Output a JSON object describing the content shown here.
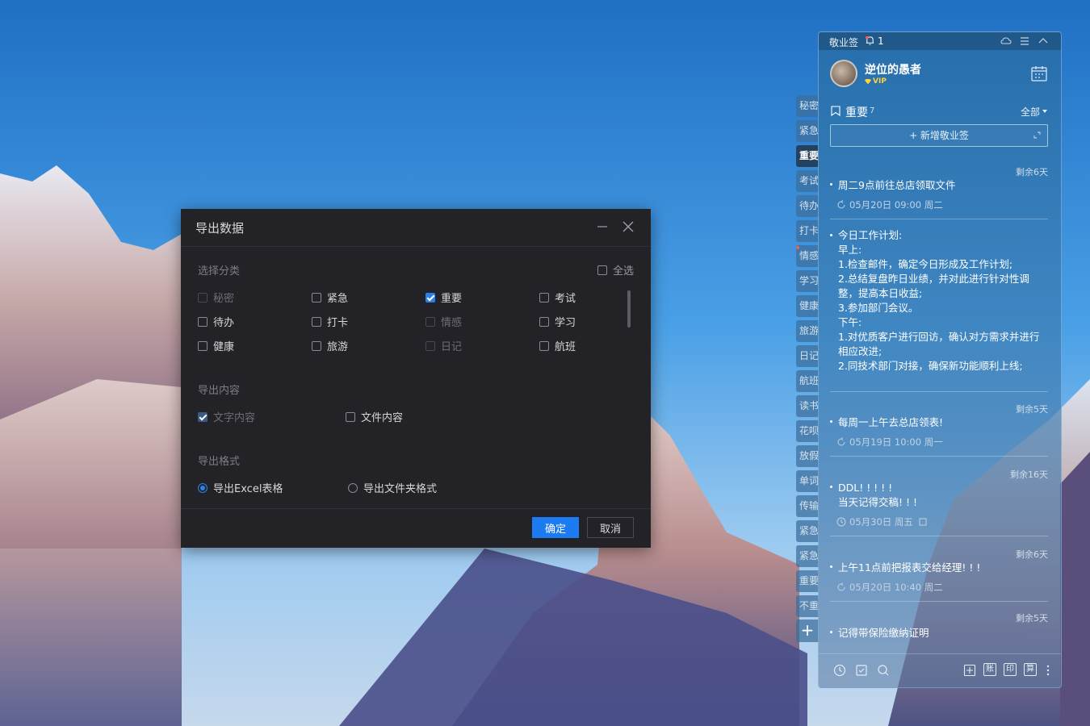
{
  "dialog": {
    "title": "导出数据",
    "category_label": "选择分类",
    "select_all": "全选",
    "categories": [
      {
        "label": "秘密",
        "checked": false,
        "disabled": true
      },
      {
        "label": "紧急",
        "checked": false,
        "disabled": false
      },
      {
        "label": "重要",
        "checked": true,
        "disabled": false
      },
      {
        "label": "考试",
        "checked": false,
        "disabled": false
      },
      {
        "label": "待办",
        "checked": false,
        "disabled": false
      },
      {
        "label": "打卡",
        "checked": false,
        "disabled": false
      },
      {
        "label": "情感",
        "checked": false,
        "disabled": true
      },
      {
        "label": "学习",
        "checked": false,
        "disabled": false
      },
      {
        "label": "健康",
        "checked": false,
        "disabled": false
      },
      {
        "label": "旅游",
        "checked": false,
        "disabled": false
      },
      {
        "label": "日记",
        "checked": false,
        "disabled": true
      },
      {
        "label": "航班",
        "checked": false,
        "disabled": false
      }
    ],
    "content_label": "导出内容",
    "content_text": "文字内容",
    "content_file": "文件内容",
    "format_label": "导出格式",
    "format_excel": "导出Excel表格",
    "format_folder": "导出文件夹格式",
    "ok": "确定",
    "cancel": "取消"
  },
  "side_tabs": [
    "秘密",
    "紧急",
    "重要",
    "考试",
    "待办",
    "打卡",
    "情感",
    "学习",
    "健康",
    "旅游",
    "日记",
    "航班",
    "读书",
    "花呗",
    "放假",
    "单词",
    "传输",
    "紧急",
    "紧急",
    "重要",
    "不重"
  ],
  "side_tab_add": "+",
  "panel": {
    "app_name": "敬业签",
    "notification_count": "1",
    "user_name": "逆位的愚者",
    "vip": "VIP",
    "category": "重要",
    "category_count": "7",
    "filter": "全部",
    "new_note": "+ 新增敬业签",
    "notes": [
      {
        "remain": "剩余6天",
        "text": "周二9点前往总店领取文件",
        "meta": "05月20日 09:00 周二"
      },
      {
        "text": "今日工作计划:\n早上:\n1.检查邮件，确定今日形成及工作计划;\n2.总结复盘昨日业绩，并对此进行针对性调整，提高本日收益;\n3.参加部门会议。\n下午:\n1.对优质客户进行回访，确认对方需求并进行相应改进;\n2.同技术部门对接，确保新功能顺利上线;"
      },
      {
        "remain": "剩余5天",
        "text": "每周一上午去总店领表!",
        "meta": "05月19日 10:00 周一"
      },
      {
        "remain": "剩余16天",
        "text": "DDL! ! ! ! !\n当天记得交稿! ! !",
        "meta": "05月30日 周五"
      },
      {
        "remain": "剩余6天",
        "text": "上午11点前把报表交给经理! ! !",
        "meta": "05月20日 10:40 周二"
      },
      {
        "remain": "剩余5天",
        "text": "记得带保险缴纳证明"
      }
    ],
    "bottom_chars": [
      "账",
      "印",
      "算"
    ]
  }
}
